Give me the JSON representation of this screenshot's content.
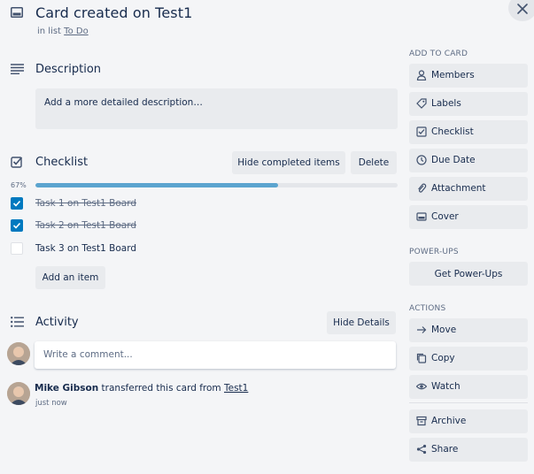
{
  "card": {
    "title": "Card created on Test1",
    "in_list_prefix": "in list",
    "list_name": "To Do"
  },
  "description": {
    "heading": "Description",
    "placeholder": "Add a more detailed description…"
  },
  "checklist": {
    "heading": "Checklist",
    "hide_completed_label": "Hide completed items",
    "delete_label": "Delete",
    "progress_text": "67%",
    "progress_fraction": 0.67,
    "items": [
      {
        "text": "Task 1 on Test1 Board",
        "checked": true
      },
      {
        "text": "Task 2 on Test1 Board",
        "checked": true
      },
      {
        "text": "Task 3 on Test1 Board",
        "checked": false
      }
    ],
    "add_item_label": "Add an item"
  },
  "activity": {
    "heading": "Activity",
    "hide_details_label": "Hide Details",
    "comment_placeholder": "Write a comment...",
    "entry": {
      "user": "Mike Gibson",
      "action": "transferred this card from",
      "board": "Test1",
      "time": "just now"
    }
  },
  "sidebar": {
    "add_to_card_heading": "ADD TO CARD",
    "add_to_card": [
      {
        "label": "Members",
        "icon": "person-icon"
      },
      {
        "label": "Labels",
        "icon": "tag-icon"
      },
      {
        "label": "Checklist",
        "icon": "checklist-icon"
      },
      {
        "label": "Due Date",
        "icon": "clock-icon"
      },
      {
        "label": "Attachment",
        "icon": "paperclip-icon"
      },
      {
        "label": "Cover",
        "icon": "cover-icon"
      }
    ],
    "powerups_heading": "POWER-UPS",
    "get_powerups_label": "Get Power-Ups",
    "actions_heading": "ACTIONS",
    "actions": [
      {
        "label": "Move",
        "icon": "arrow-right-icon"
      },
      {
        "label": "Copy",
        "icon": "copy-icon"
      },
      {
        "label": "Watch",
        "icon": "eye-icon"
      },
      {
        "label": "Archive",
        "icon": "archive-icon"
      },
      {
        "label": "Share",
        "icon": "share-icon"
      }
    ]
  },
  "colors": {
    "accent": "#0079bf",
    "progress": "#5ba4cf",
    "background": "#f4f5f7",
    "button": "#e9ebee"
  }
}
